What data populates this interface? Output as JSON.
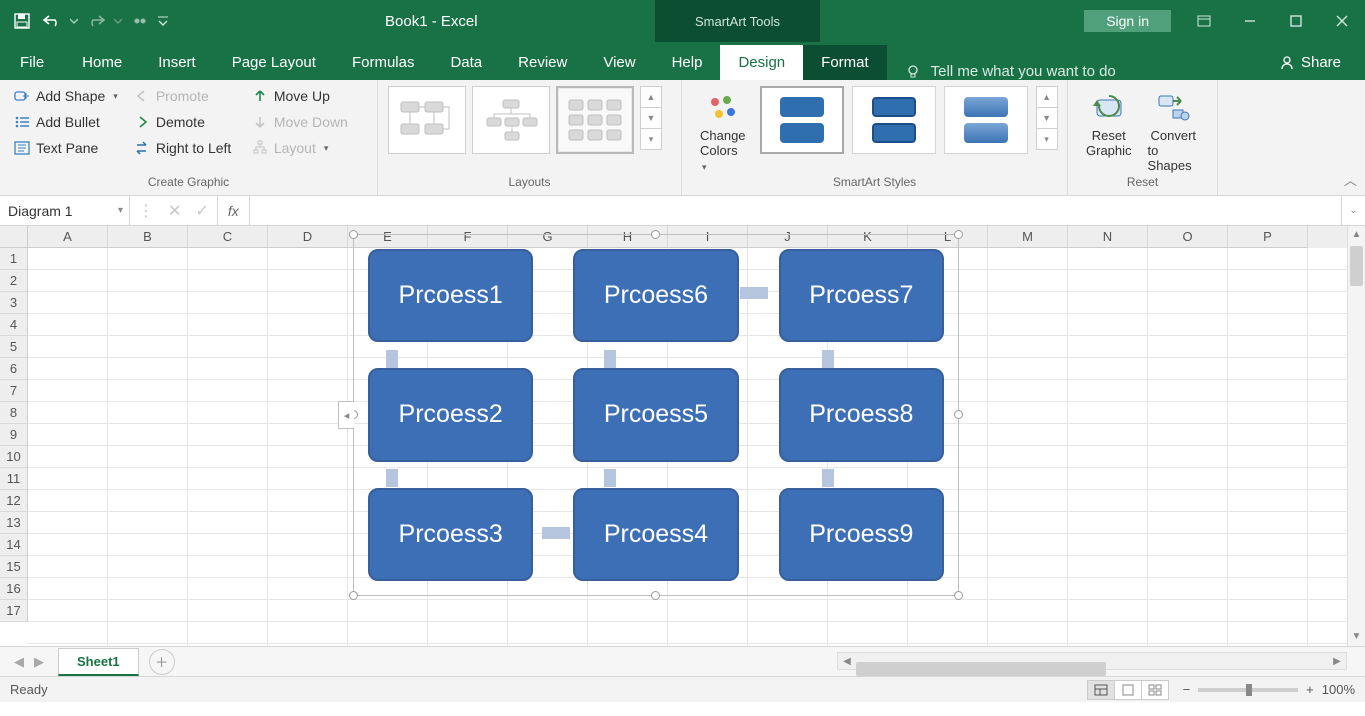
{
  "title": {
    "doc": "Book1  -  Excel",
    "context_tool": "SmartArt Tools",
    "sign_in": "Sign in"
  },
  "tabs": {
    "file": "File",
    "home": "Home",
    "insert": "Insert",
    "page_layout": "Page Layout",
    "formulas": "Formulas",
    "data": "Data",
    "review": "Review",
    "view": "View",
    "help": "Help",
    "design": "Design",
    "format": "Format",
    "tell_me": "Tell me what you want to do",
    "share": "Share"
  },
  "ribbon": {
    "create_graphic": {
      "add_shape": "Add Shape",
      "add_bullet": "Add Bullet",
      "text_pane": "Text Pane",
      "promote": "Promote",
      "demote": "Demote",
      "right_to_left": "Right to Left",
      "move_up": "Move Up",
      "move_down": "Move Down",
      "layout": "Layout",
      "group_label": "Create Graphic"
    },
    "layouts": {
      "group_label": "Layouts"
    },
    "styles": {
      "change_colors": "Change",
      "change_colors2": "Colors",
      "group_label": "SmartArt Styles"
    },
    "reset": {
      "reset_graphic1": "Reset",
      "reset_graphic2": "Graphic",
      "convert1": "Convert",
      "convert2": "to Shapes",
      "group_label": "Reset"
    }
  },
  "formula_bar": {
    "name_box": "Diagram 1",
    "fx": "fx",
    "formula": ""
  },
  "grid": {
    "columns": [
      "A",
      "B",
      "C",
      "D",
      "E",
      "F",
      "G",
      "H",
      "I",
      "J",
      "K",
      "L",
      "M",
      "N",
      "O",
      "P"
    ],
    "rows": [
      "1",
      "2",
      "3",
      "4",
      "5",
      "6",
      "7",
      "8",
      "9",
      "10",
      "11",
      "12",
      "13",
      "14",
      "15",
      "16",
      "17"
    ]
  },
  "smartart": {
    "nodes": [
      "Prcoess1",
      "Prcoess6",
      "Prcoess7",
      "Prcoess2",
      "Prcoess5",
      "Prcoess8",
      "Prcoess3",
      "Prcoess4",
      "Prcoess9"
    ]
  },
  "sheet_tabs": {
    "active": "Sheet1"
  },
  "status": {
    "ready": "Ready",
    "zoom": "100%"
  }
}
